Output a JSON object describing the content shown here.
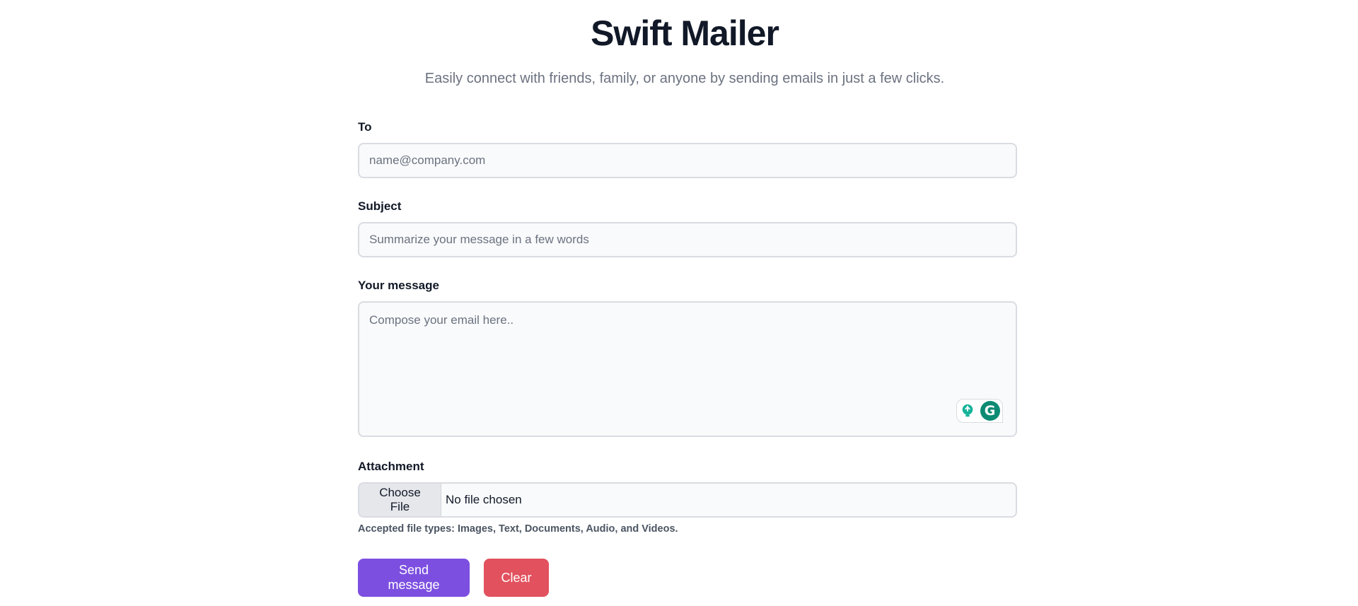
{
  "header": {
    "title": "Swift Mailer",
    "subtitle": "Easily connect with friends, family, or anyone by sending emails in just a few clicks."
  },
  "form": {
    "to": {
      "label": "To",
      "value": "",
      "placeholder": "name@company.com"
    },
    "subject": {
      "label": "Subject",
      "value": "",
      "placeholder": "Summarize your message in a few words"
    },
    "message": {
      "label": "Your message",
      "value": "",
      "placeholder": "Compose your email here.."
    },
    "attachment": {
      "label": "Attachment",
      "button_label": "Choose File",
      "status": "No file chosen",
      "hint": "Accepted file types: Images, Text, Documents, Audio, and Videos."
    },
    "grammarly": {
      "logo_letter": "G",
      "icons": [
        "lightbulb-icon",
        "grammarly-icon"
      ]
    }
  },
  "actions": {
    "send_label": "Send message",
    "clear_label": "Clear"
  },
  "colors": {
    "send": "#7c4fe0",
    "clear": "#e2515e",
    "grammarly": "#0d8a73",
    "field_bg": "#f9fafb",
    "field_border": "#d9dce1"
  }
}
